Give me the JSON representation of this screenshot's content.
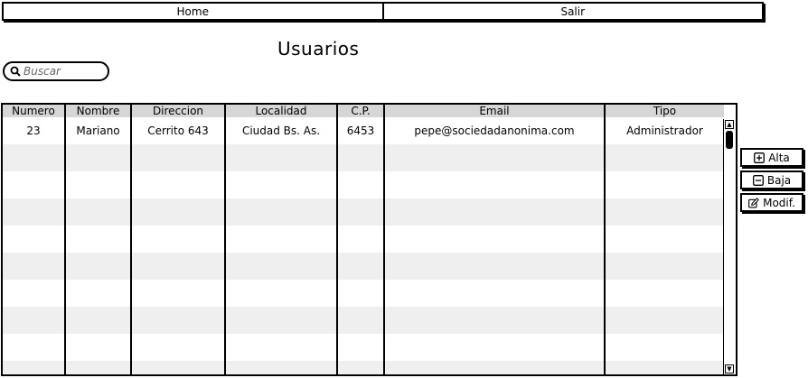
{
  "nav": {
    "home_label": "Home",
    "exit_label": "Salir"
  },
  "page": {
    "title": "Usuarios"
  },
  "search": {
    "placeholder": "Buscar",
    "value": "",
    "icon": "search-icon"
  },
  "table": {
    "columns": [
      "Numero",
      "Nombre",
      "Direccion",
      "Localidad",
      "C.P.",
      "Email",
      "Tipo"
    ],
    "rows": [
      [
        "23",
        "Mariano",
        "Cerrito 643",
        "Ciudad Bs. As.",
        "6453",
        "pepe@sociedadanonima.com",
        "Administrador"
      ]
    ]
  },
  "actions": {
    "add": {
      "label": "Alta",
      "icon": "plus-box-icon"
    },
    "remove": {
      "label": "Baja",
      "icon": "minus-box-icon"
    },
    "edit": {
      "label": "Modif.",
      "icon": "edit-icon"
    }
  }
}
